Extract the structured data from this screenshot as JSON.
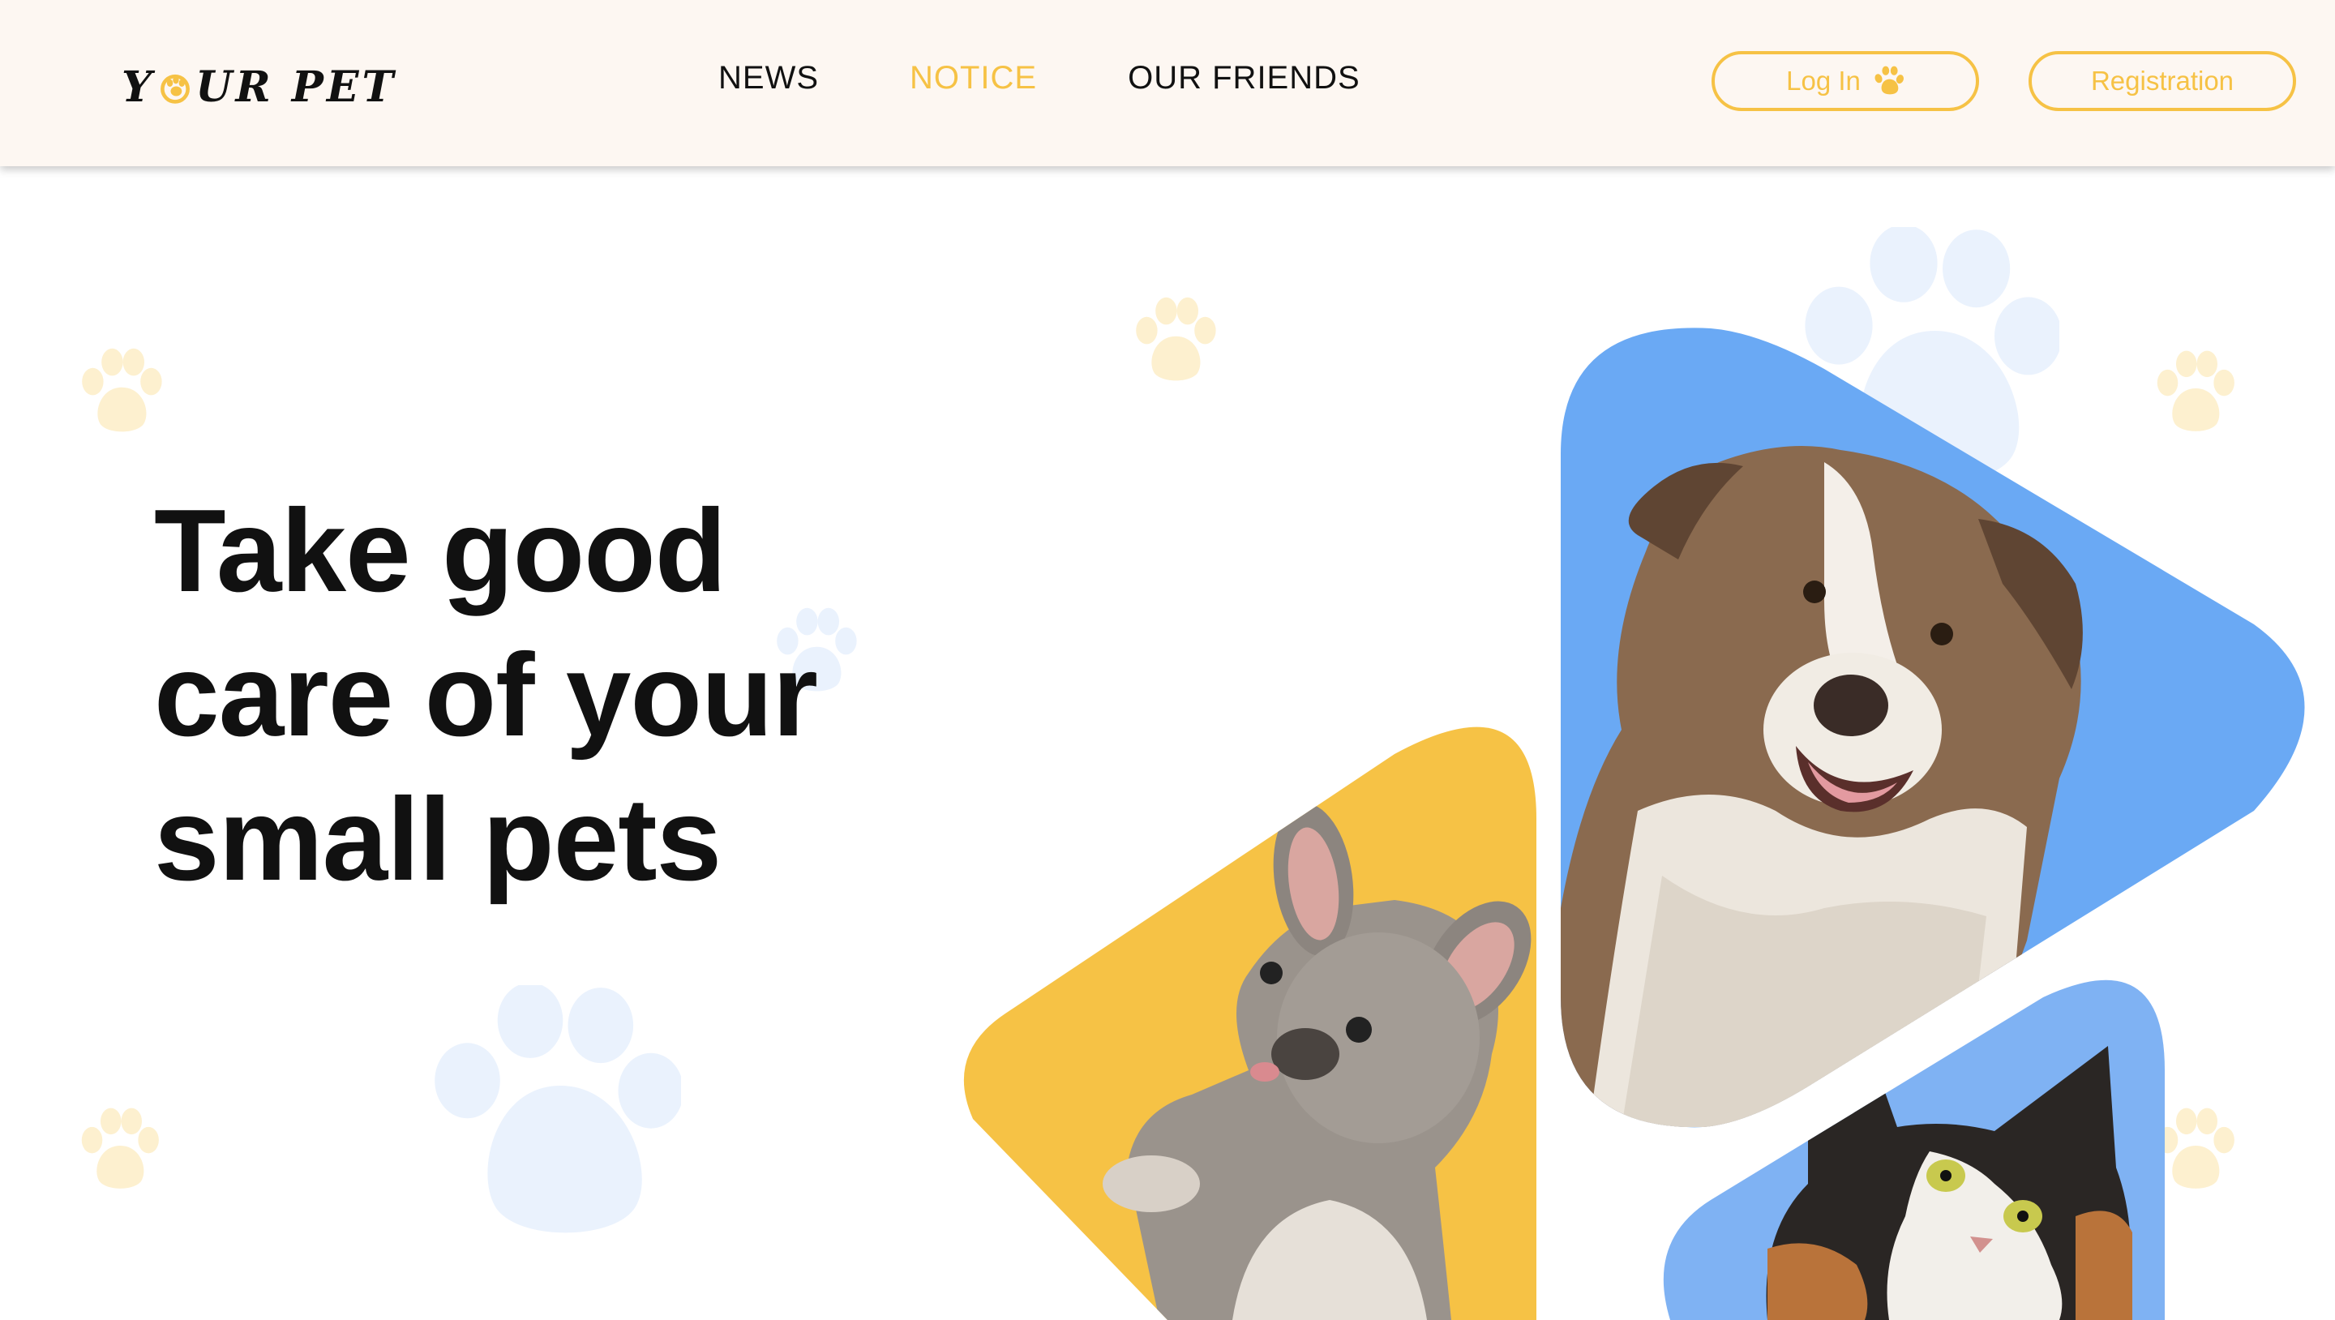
{
  "logo": {
    "part1": "Y",
    "part2": "UR PET"
  },
  "nav": {
    "items": [
      {
        "label": "NEWS",
        "active": false
      },
      {
        "label": "NOTICE",
        "active": true
      },
      {
        "label": "OUR FRIENDS",
        "active": false
      }
    ]
  },
  "auth": {
    "login_label": "Log In",
    "register_label": "Registration"
  },
  "hero": {
    "line1": "Take good",
    "line2": "care of your",
    "line3": "small pets"
  },
  "colors": {
    "accent": "#f6c245",
    "blue": "#6aa9f4",
    "header_bg": "#fdf7f2",
    "text": "#111111"
  },
  "icons": [
    "paw-icon",
    "paw-o-icon"
  ]
}
